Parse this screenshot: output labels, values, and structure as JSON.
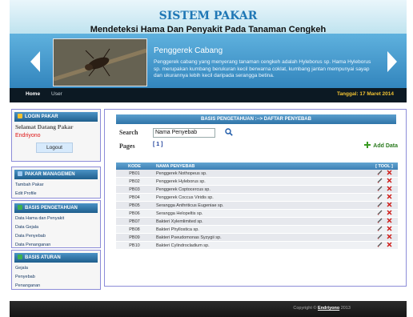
{
  "header": {
    "title": "SISTEM PAKAR",
    "subtitle": "Mendeteksi Hama Dan Penyakit Pada Tanaman Cengkeh"
  },
  "banner": {
    "title": "Penggerek Cabang",
    "text": "Penggerek cabang yang menyerang tanaman cengkeh adalah Hyleborus sp. Hama Hyleborus sp. merupakan kumbang berukuran kecil berwarna coklat, kumbang jantan mempunyai sayap dan ukurannya lebih kecil daripada serangga betina."
  },
  "nav": {
    "home": "Home",
    "user": "User",
    "date": "Tanggal: 17 Maret 2014"
  },
  "sidebar": {
    "login": {
      "title": "LOGIN PAKAR",
      "welcome": "Selamat Datang Pakar",
      "username": "Endriyono",
      "logout": "Logout"
    },
    "pakar": {
      "title": "PAKAR MANAGEMEN",
      "items": [
        "Tambah Pakar",
        "Edit Profile"
      ]
    },
    "basis": {
      "title": "BASIS PENGETAHUAN",
      "items": [
        "Data Hama dan Penyakit",
        "Data Gejala",
        "Data Penyebab",
        "Data Penanganan"
      ]
    },
    "aturan": {
      "title": "BASIS ATURAN",
      "items": [
        "Gejala",
        "Penyebab",
        "Penanganan"
      ]
    }
  },
  "main": {
    "heading": "BASIS PENGETAHUAN :--> DAFTAR PENYEBAB",
    "search_label": "Search",
    "search_value": "Nama Penyebab",
    "pages_label": "Pages",
    "pages_value": "[ 1 ]",
    "add_label": "Add Data",
    "columns": [
      "KODE",
      "NAMA PENYEBAB",
      "[ TOOL ]"
    ],
    "rows": [
      {
        "kode": "PB01",
        "nama": "Penggerek Nothopeus sp."
      },
      {
        "kode": "PB02",
        "nama": "Penggerek Hyleborus sp."
      },
      {
        "kode": "PB03",
        "nama": "Penggerek Coptocercus sp."
      },
      {
        "kode": "PB04",
        "nama": "Penggerek Coccus Viridis sp."
      },
      {
        "kode": "PB05",
        "nama": "Serangga Anthriticus Eugeniae sp."
      },
      {
        "kode": "PB06",
        "nama": "Serangga Helopeltis sp."
      },
      {
        "kode": "PB07",
        "nama": "Bakteri Xylemlimited sp."
      },
      {
        "kode": "PB08",
        "nama": "Bakteri Phyllostica sp."
      },
      {
        "kode": "PB09",
        "nama": "Bakteri Pseudomonas Syzygii sp."
      },
      {
        "kode": "PB10",
        "nama": "Bakteri Cylindrocladium sp."
      }
    ]
  },
  "footer": {
    "prefix": "Copyright ©",
    "author": "Endriyono",
    "year": "2013"
  },
  "colors": {
    "title_blue": "#1f77b5",
    "banner_blue": "#3285bd",
    "nav_dark": "#0c1923",
    "date_yellow": "#f1c232",
    "delete_red": "#d0201c"
  }
}
